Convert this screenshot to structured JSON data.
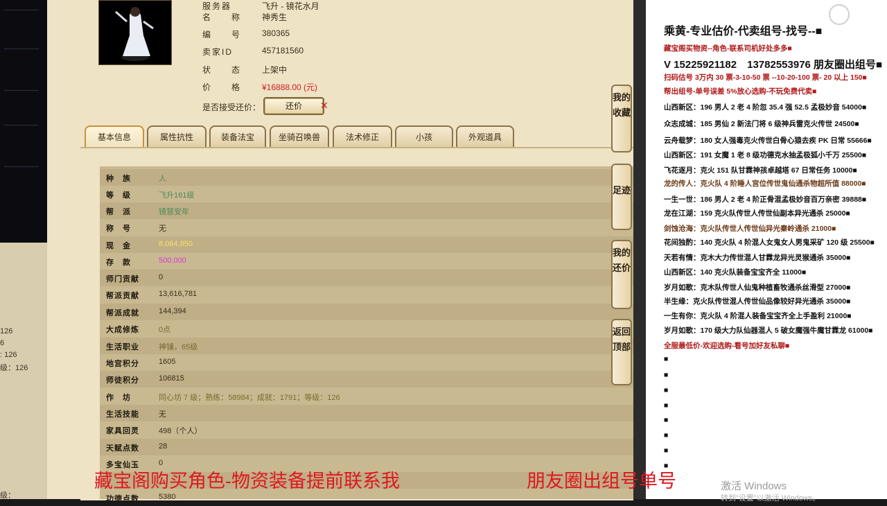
{
  "left_strip": {
    "values": [
      "126",
      "6",
      ": 126",
      "级：126",
      "级："
    ]
  },
  "info": {
    "fields": [
      {
        "label": "服务器",
        "value": "飞升 - 镜花水月"
      },
      {
        "label": "名　　称",
        "value": "神秀生"
      },
      {
        "label": "编　　号",
        "value": "380365"
      },
      {
        "label": "卖家ID",
        "value": "457181560"
      },
      {
        "label": "状　　态",
        "value": "上架中"
      },
      {
        "label": "价　　格",
        "value": "¥16888.00 (元)"
      }
    ],
    "haggle_label": "是否接受还价：",
    "haggle_button": "还价",
    "haggle_close": "✕"
  },
  "tabs": [
    {
      "label": "基本信息",
      "active": true
    },
    {
      "label": "属性抗性",
      "active": false
    },
    {
      "label": "装备法宝",
      "active": false
    },
    {
      "label": "坐骑召唤兽",
      "active": false
    },
    {
      "label": "法术修正",
      "active": false
    },
    {
      "label": "小孩",
      "active": false
    },
    {
      "label": "外观道具",
      "active": false
    }
  ],
  "table": [
    {
      "key": "种　族",
      "value": "人",
      "style": "green"
    },
    {
      "key": "等　级",
      "value": "飞升161级",
      "style": "green"
    },
    {
      "key": "帮　派",
      "value": "镜慧安年",
      "style": "green"
    },
    {
      "key": "称　号",
      "value": "无",
      "style": ""
    },
    {
      "key": "现　金",
      "value": "8,064,850",
      "style": "yellow"
    },
    {
      "key": "存　款",
      "value": "500,000",
      "style": "pink"
    },
    {
      "key": "师门贡献",
      "value": "0",
      "style": ""
    },
    {
      "key": "帮派贡献",
      "value": "13,616,781",
      "style": ""
    },
    {
      "key": "帮派成就",
      "value": "144,394",
      "style": ""
    },
    {
      "key": "大成修炼",
      "value": "0点",
      "style": "olive"
    },
    {
      "key": "生活职业",
      "value": "神铺，65级",
      "style": "olive"
    },
    {
      "key": "地宫积分",
      "value": "1605",
      "style": ""
    },
    {
      "key": "师徒积分",
      "value": "106815",
      "style": ""
    },
    {
      "key": "作　坊",
      "value": "同心坊 7 级；熟练：58984；成就：1791；等级：126",
      "style": "olive"
    },
    {
      "key": "生活技能",
      "value": "无",
      "style": ""
    },
    {
      "key": "家具回灵",
      "value": "498（个人）",
      "style": ""
    },
    {
      "key": "天赋点数",
      "value": "28",
      "style": ""
    },
    {
      "key": "多宝仙玉",
      "value": "0",
      "style": ""
    },
    {
      "key": "",
      "value": "",
      "style": ""
    },
    {
      "key": "功德点数",
      "value": "5380",
      "style": ""
    }
  ],
  "side_buttons": [
    "我的收藏",
    "足迹",
    "我的还价",
    "返回顶部"
  ],
  "right_panel": {
    "lines": [
      {
        "text": "乘黄-专业估价-代卖组号-找号--■",
        "cls": "title"
      },
      {
        "text": "藏宝阁买物资--角色-联系司机好处多多■",
        "cls": "red"
      },
      {
        "text": "V 15225921182　13782553976 朋友圈出组号■",
        "cls": "big"
      },
      {
        "text": "扫码估号 3万内 30 票-3-10-50 票 --10-20-100 票- 20 以上 150■",
        "cls": "red"
      },
      {
        "text": "帮出组号-单号误差 5%放心选购-不玩免费代卖■",
        "cls": "red"
      },
      {
        "text": "山西新区：196 男人 2 老 4 阶忽 35.4 强 52.5 孟极妙音 54000■",
        "cls": ""
      },
      {
        "text": "众志成城：185 男仙 2 新法门将 6 级神兵雷克火传世 24500■",
        "cls": ""
      },
      {
        "text": "云舟载梦：180 女人强毒克火传世白骨心猿去疾 PK 日常 55666■",
        "cls": ""
      },
      {
        "text": "山西新区：191 女魔 1 老 8 级功德克水抽孟极狐小千万 25500■",
        "cls": ""
      },
      {
        "text": "飞花逐月：克火 151 队甘霖神孩卓越塔 67 日常任务 10000■",
        "cls": ""
      },
      {
        "text": "龙的传人：克火队 4 阶睡人宫位传世鬼仙通杀物超所值 88000■",
        "cls": "brown"
      },
      {
        "text": "一生一世：186 男人 2 老 4 阶正骨混孟极妙音百万亲密 39888■",
        "cls": ""
      },
      {
        "text": "龙在江湖：159 克火队传世人传世仙副本异光通杀 25000■",
        "cls": ""
      },
      {
        "text": "剑蚀沧海：克火队传世人传世仙异光秦岭通杀 21000■",
        "cls": "brown"
      },
      {
        "text": "花间独酌：140 克火队 4 阶混人女鬼女人男鬼采矿 120 级 25500■",
        "cls": ""
      },
      {
        "text": "天若有情：克木大力传世混人甘霖龙异光灵猴通杀 35000■",
        "cls": ""
      },
      {
        "text": "山西新区：140 克火队装备宝宝齐全 11000■",
        "cls": ""
      },
      {
        "text": "岁月如歌：克木队传世人仙鬼种植畜牧通杀丝滑型 27000■",
        "cls": ""
      },
      {
        "text": "半生缘：克火队传世混人传世仙品像较好异光通杀 35000■",
        "cls": ""
      },
      {
        "text": "一生有你：克火队 4 阶混人装备宝宝齐全上手盈利 21000■",
        "cls": ""
      },
      {
        "text": "岁月如歌：170 级大力队仙器混人 5 破女魔强牛魔甘霖龙 61000■",
        "cls": ""
      },
      {
        "text": "全服最低价-欢迎选购-看号加好友私聊■",
        "cls": "red"
      },
      {
        "text": "■",
        "cls": ""
      },
      {
        "text": "■",
        "cls": ""
      },
      {
        "text": "■",
        "cls": ""
      },
      {
        "text": "■",
        "cls": ""
      },
      {
        "text": "■",
        "cls": ""
      },
      {
        "text": "■",
        "cls": ""
      },
      {
        "text": "■",
        "cls": ""
      },
      {
        "text": "■",
        "cls": ""
      }
    ]
  },
  "overlay": {
    "text_left": "藏宝阁购买角色-物资装备提前联系我",
    "text_right": "朋友圈出组号单号"
  },
  "watermark": {
    "title": "激活 Windows",
    "subtitle": "转到\"设置\"以激活 Windows。"
  },
  "colors": {
    "panel_bg": "#efe3c6",
    "table_bg": "#c9b991",
    "overlay_red": "#e0171f",
    "price_red": "#d21a1a"
  }
}
